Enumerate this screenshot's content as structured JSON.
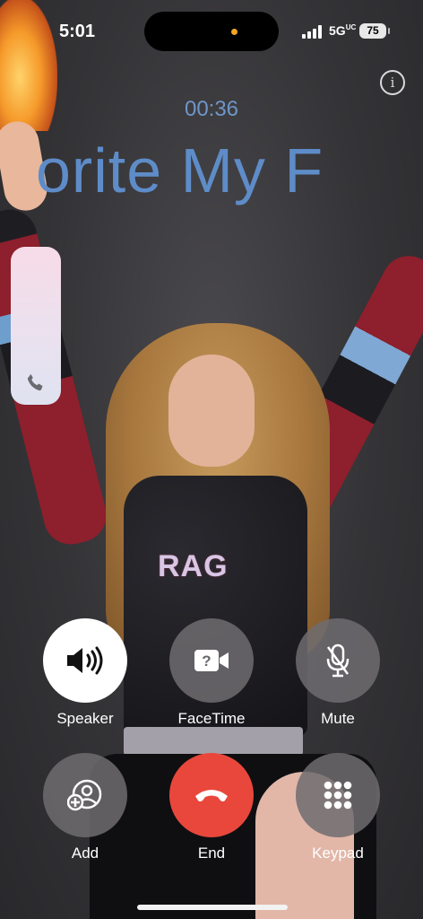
{
  "status_bar": {
    "time": "5:01",
    "network": "5G",
    "network_sub": "UC",
    "battery": "75"
  },
  "call": {
    "duration": "00:36",
    "caller_name": "orite  My F"
  },
  "controls": {
    "speaker": "Speaker",
    "facetime": "FaceTime",
    "mute": "Mute",
    "add": "Add",
    "end": "End",
    "keypad": "Keypad"
  },
  "background": {
    "jersey_text": "RAG"
  },
  "icons": {
    "info": "info-icon",
    "speaker": "speaker-icon",
    "facetime": "facetime-unavailable-icon",
    "mute": "mic-slash-icon",
    "add": "add-person-icon",
    "end": "end-call-icon",
    "keypad": "keypad-icon",
    "slider": "phone-icon"
  },
  "colors": {
    "end_red": "#e9473b",
    "caller_blue": "#5e8cc8"
  }
}
